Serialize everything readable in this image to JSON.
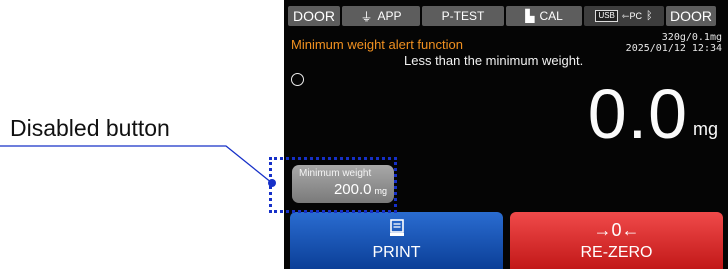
{
  "annotation": {
    "label": "Disabled button"
  },
  "status_bar": {
    "door_left": "DOOR",
    "app": "APP",
    "p_test": "P-TEST",
    "cal": "CAL",
    "usb": "USB",
    "pc": "PC",
    "door_right": "DOOR"
  },
  "alert": {
    "title": "Minimum weight alert function",
    "message": "Less than the minimum weight."
  },
  "range_info": {
    "capacity": "320g/0.1mg",
    "datetime": "2025/01/12  12:34"
  },
  "display": {
    "value": "0.0",
    "unit": "mg"
  },
  "min_weight": {
    "label": "Minimum weight",
    "value": "200.0",
    "unit": "mg"
  },
  "buttons": {
    "print": "PRINT",
    "rezero": "RE-ZERO",
    "rezero_icon": "→0←"
  },
  "colors": {
    "alert_text": "#f09020",
    "print_button": "#1a56b8",
    "rezero_button": "#d42a2a",
    "highlight": "#1630c8"
  }
}
